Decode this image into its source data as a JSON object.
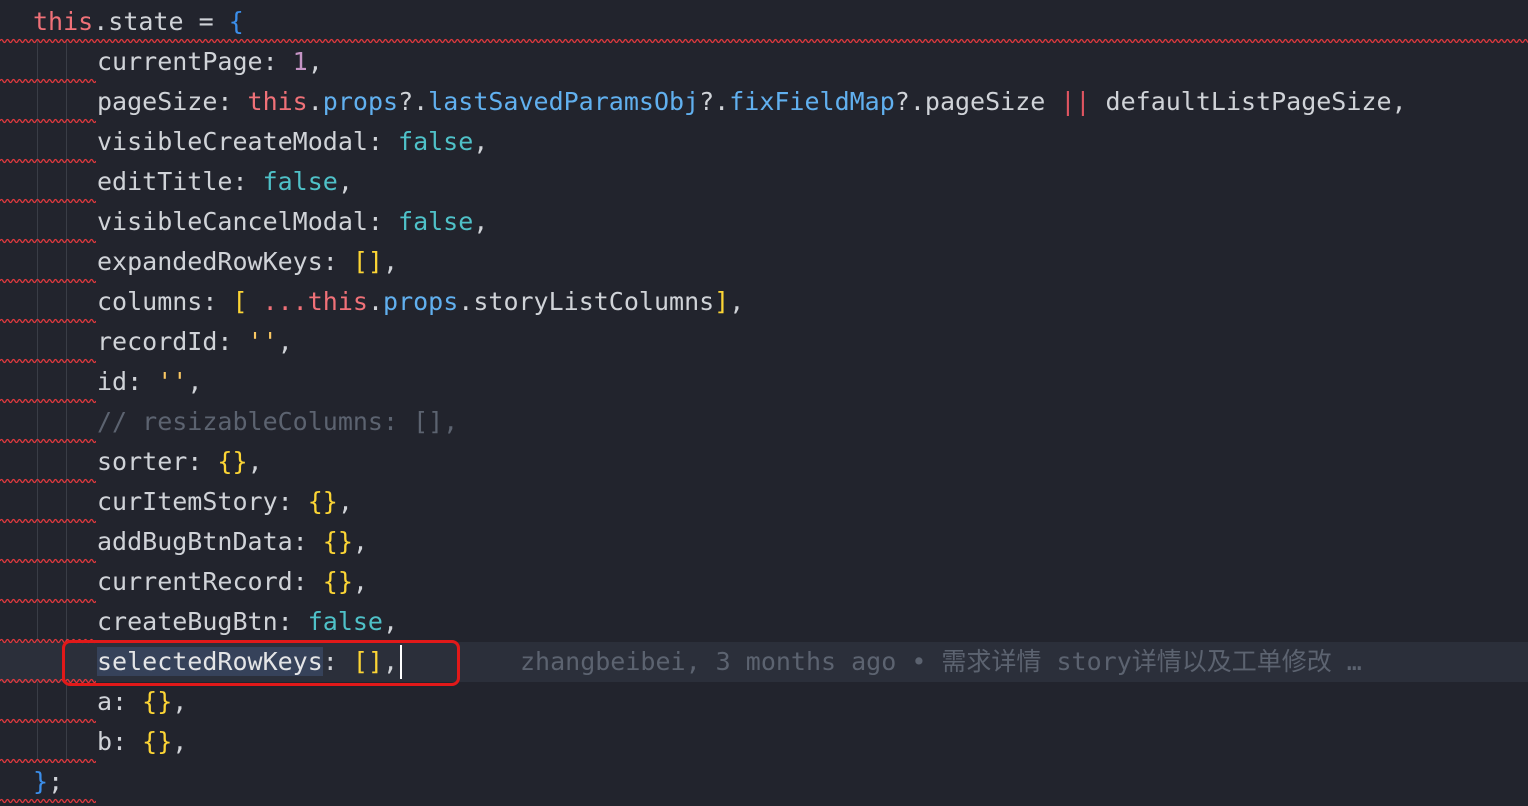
{
  "colors": {
    "background": "#22242d",
    "current_line": "#2b2f3a",
    "keyword": "#f07178",
    "property": "#61b0ef",
    "boolean": "#4fc1c8",
    "number": "#c594c5",
    "string": "#fac863",
    "bracket": "#fcd535",
    "comment": "#5c6370",
    "annotation_box": "#e11919",
    "squiggle": "#e0393e"
  },
  "code": {
    "lines": [
      {
        "tokens": [
          [
            "this",
            "kw"
          ],
          [
            ".state = ",
            "op"
          ],
          [
            "{",
            "brace-blue"
          ]
        ]
      },
      {
        "tokens": [
          [
            "currentPage: ",
            "op"
          ],
          [
            "1",
            "num"
          ],
          [
            ",",
            "op"
          ]
        ]
      },
      {
        "tokens": [
          [
            "pageSize: ",
            "op"
          ],
          [
            "this",
            "kw"
          ],
          [
            ".",
            "op"
          ],
          [
            "props",
            "prop"
          ],
          [
            "?.",
            "op"
          ],
          [
            "lastSavedParamsObj",
            "prop"
          ],
          [
            "?.",
            "op"
          ],
          [
            "fixFieldMap",
            "prop"
          ],
          [
            "?.",
            "op"
          ],
          [
            "pageSize ",
            "op"
          ],
          [
            "||",
            "oror"
          ],
          [
            " defaultListPageSize,",
            "op"
          ]
        ]
      },
      {
        "tokens": [
          [
            "visibleCreateModal: ",
            "op"
          ],
          [
            "false",
            "bool"
          ],
          [
            ",",
            "op"
          ]
        ]
      },
      {
        "tokens": [
          [
            "editTitle: ",
            "op"
          ],
          [
            "false",
            "bool"
          ],
          [
            ",",
            "op"
          ]
        ]
      },
      {
        "tokens": [
          [
            "visibleCancelModal: ",
            "op"
          ],
          [
            "false",
            "bool"
          ],
          [
            ",",
            "op"
          ]
        ]
      },
      {
        "tokens": [
          [
            "expandedRowKeys: ",
            "op"
          ],
          [
            "[]",
            "bracket"
          ],
          [
            ",",
            "op"
          ]
        ]
      },
      {
        "tokens": [
          [
            "columns: ",
            "op"
          ],
          [
            "[",
            "bracket"
          ],
          [
            " ...",
            "kw"
          ],
          [
            "this",
            "kw"
          ],
          [
            ".",
            "op"
          ],
          [
            "props",
            "prop"
          ],
          [
            ".storyListColumns",
            "op"
          ],
          [
            "]",
            "bracket"
          ],
          [
            ",",
            "op"
          ]
        ]
      },
      {
        "tokens": [
          [
            "recordId: ",
            "op"
          ],
          [
            "''",
            "str"
          ],
          [
            ",",
            "op"
          ]
        ]
      },
      {
        "tokens": [
          [
            "id: ",
            "op"
          ],
          [
            "''",
            "str"
          ],
          [
            ",",
            "op"
          ]
        ]
      },
      {
        "tokens": [
          [
            "// resizableColumns: [],",
            "comment"
          ]
        ]
      },
      {
        "tokens": [
          [
            "sorter: ",
            "op"
          ],
          [
            "{}",
            "bracket"
          ],
          [
            ",",
            "op"
          ]
        ]
      },
      {
        "tokens": [
          [
            "curItemStory: ",
            "op"
          ],
          [
            "{}",
            "bracket"
          ],
          [
            ",",
            "op"
          ]
        ]
      },
      {
        "tokens": [
          [
            "addBugBtnData: ",
            "op"
          ],
          [
            "{}",
            "bracket"
          ],
          [
            ",",
            "op"
          ]
        ]
      },
      {
        "tokens": [
          [
            "currentRecord: ",
            "op"
          ],
          [
            "{}",
            "bracket"
          ],
          [
            ",",
            "op"
          ]
        ]
      },
      {
        "tokens": [
          [
            "createBugBtn: ",
            "op"
          ],
          [
            "false",
            "bool"
          ],
          [
            ",",
            "op"
          ]
        ]
      },
      {
        "tokens": [
          [
            "selectedRowKeys",
            "sel"
          ],
          [
            ": ",
            "op"
          ],
          [
            "[]",
            "bracket"
          ],
          [
            ",",
            "op"
          ]
        ],
        "current": true
      },
      {
        "tokens": [
          [
            "a: ",
            "op"
          ],
          [
            "{}",
            "bracket"
          ],
          [
            ",",
            "op"
          ]
        ]
      },
      {
        "tokens": [
          [
            "b: ",
            "op"
          ],
          [
            "{}",
            "bracket"
          ],
          [
            ",",
            "op"
          ]
        ]
      },
      {
        "tokens": [
          [
            "}",
            "brace-blue"
          ],
          [
            ";",
            "op"
          ]
        ]
      }
    ]
  },
  "blame": {
    "text": "zhangbeibei, 3 months ago • 需求详情 story详情以及工单修改 …"
  }
}
